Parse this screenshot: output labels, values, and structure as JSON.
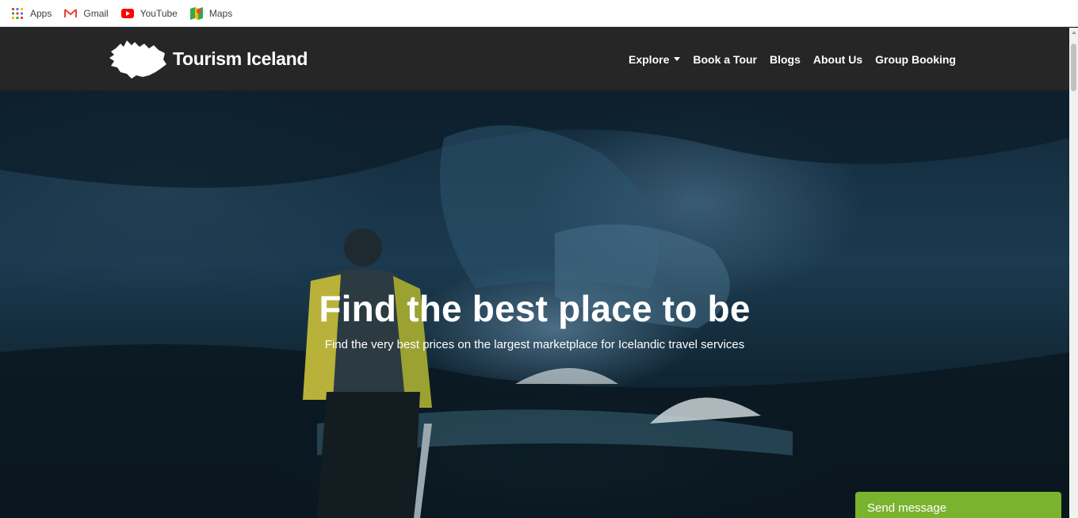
{
  "bookmarks": [
    {
      "label": "Apps",
      "icon": "apps-grid-icon"
    },
    {
      "label": "Gmail",
      "icon": "gmail-icon"
    },
    {
      "label": "YouTube",
      "icon": "youtube-icon"
    },
    {
      "label": "Maps",
      "icon": "maps-icon"
    }
  ],
  "header": {
    "logo_text": "Tourism Iceland",
    "nav": {
      "explore": "Explore",
      "book_tour": "Book a Tour",
      "blogs": "Blogs",
      "about": "About Us",
      "group_booking": "Group Booking"
    }
  },
  "hero": {
    "title": "Find the best place to be",
    "subtitle": "Find the very best prices on the largest marketplace for Icelandic travel services"
  },
  "chat": {
    "label": "Send message"
  },
  "colors": {
    "header_bg": "#262626",
    "chat_bg": "#7ab32e"
  }
}
